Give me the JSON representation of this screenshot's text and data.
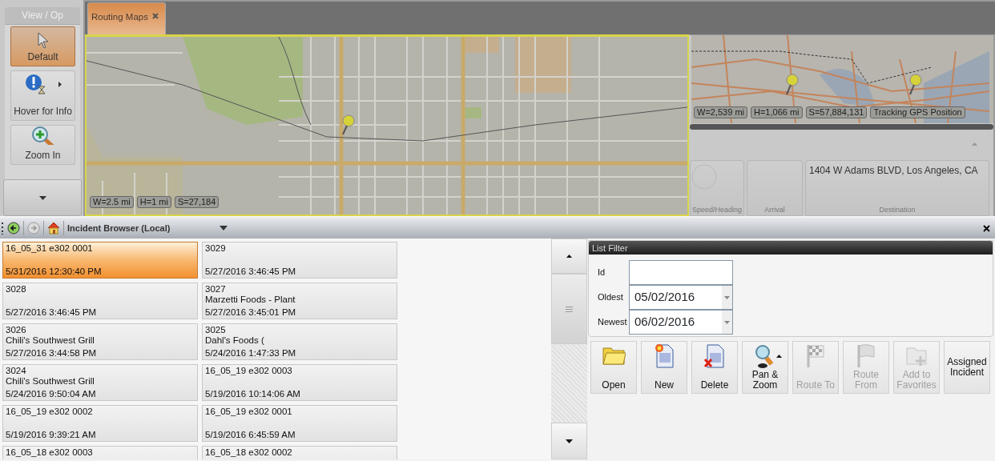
{
  "toolbox": {
    "title": "View / Op",
    "tools": [
      {
        "label": "Default",
        "kind": "pointer",
        "selected": true
      },
      {
        "label": "Hover for Info",
        "kind": "info",
        "selected": false
      },
      {
        "label": "Zoom In",
        "kind": "zoom",
        "selected": false
      }
    ]
  },
  "tabs": [
    {
      "label": "Routing Maps",
      "selected": true
    }
  ],
  "main_map": {
    "scale_chips": [
      "W=2.5 mi",
      "H=1 mi",
      "S=27,184"
    ]
  },
  "overview_map": {
    "scale_chips": [
      "W=2,539 mi",
      "H=1,066 mi",
      "S=57,884,131",
      "Tracking GPS Position"
    ]
  },
  "gauges": [
    {
      "label": "Speed/Heading",
      "kind": "dial"
    },
    {
      "label": "Arrival",
      "kind": "blank"
    },
    {
      "label": "Destination",
      "kind": "text",
      "value": "1404 W Adams BLVD, Los Angeles, CA"
    }
  ],
  "browser": {
    "title": "Incident Browser (Local)"
  },
  "incidents": [
    {
      "id": "16_05_31 e302 0001",
      "time": "5/31/2016 12:30:40 PM",
      "selected": true
    },
    {
      "id": "3029",
      "time": "5/27/2016 3:46:45 PM",
      "selected": false
    },
    {
      "id": "3028",
      "time": "5/27/2016 3:46:45 PM",
      "selected": false
    },
    {
      "id": "3027",
      "name": "Marzetti Foods - Plant",
      "time": "5/27/2016 3:45:01 PM",
      "selected": false
    },
    {
      "id": "3026",
      "name": "Chili's Southwest Grill",
      "time": "5/27/2016 3:44:58 PM",
      "selected": false
    },
    {
      "id": "3025",
      "name": "Dahl's Foods (",
      "time": "5/24/2016 1:47:33 PM",
      "selected": false
    },
    {
      "id": "3024",
      "name": "Chili's Southwest Grill",
      "time": "5/24/2016 9:50:04 AM",
      "selected": false
    },
    {
      "id": "16_05_19 e302 0003",
      "time": "5/19/2016 10:14:06 AM",
      "selected": false
    },
    {
      "id": "16_05_19 e302 0002",
      "time": "5/19/2016 9:39:21 AM",
      "selected": false
    },
    {
      "id": "16_05_19 e302 0001",
      "time": "5/19/2016 6:45:59 AM",
      "selected": false
    },
    {
      "id": "16_05_18 e302 0003",
      "selected": false
    },
    {
      "id": "16_05_18 e302 0002",
      "selected": false
    }
  ],
  "filter": {
    "title": "List Filter",
    "fields": [
      {
        "label": "Id",
        "kind": "text"
      },
      {
        "label": "Oldest",
        "kind": "date",
        "value": "05/02/2016"
      },
      {
        "label": "Newest",
        "kind": "date",
        "value": "06/02/2016"
      }
    ]
  },
  "actions": [
    {
      "label": "Open",
      "kind": "folder",
      "disabled": false
    },
    {
      "label": "New",
      "kind": "new",
      "disabled": false
    },
    {
      "label": "Delete",
      "kind": "delete",
      "disabled": false
    },
    {
      "label": "Pan & Zoom",
      "kind": "panzoom",
      "disabled": false
    },
    {
      "label": "Route To",
      "kind": "checkered-flag",
      "disabled": true
    },
    {
      "label": "Route From",
      "kind": "flag",
      "disabled": true
    },
    {
      "label": "Add to Favorites",
      "kind": "favorites",
      "disabled": true
    },
    {
      "label": "Assigned Incident",
      "kind": "text",
      "disabled": false
    }
  ]
}
